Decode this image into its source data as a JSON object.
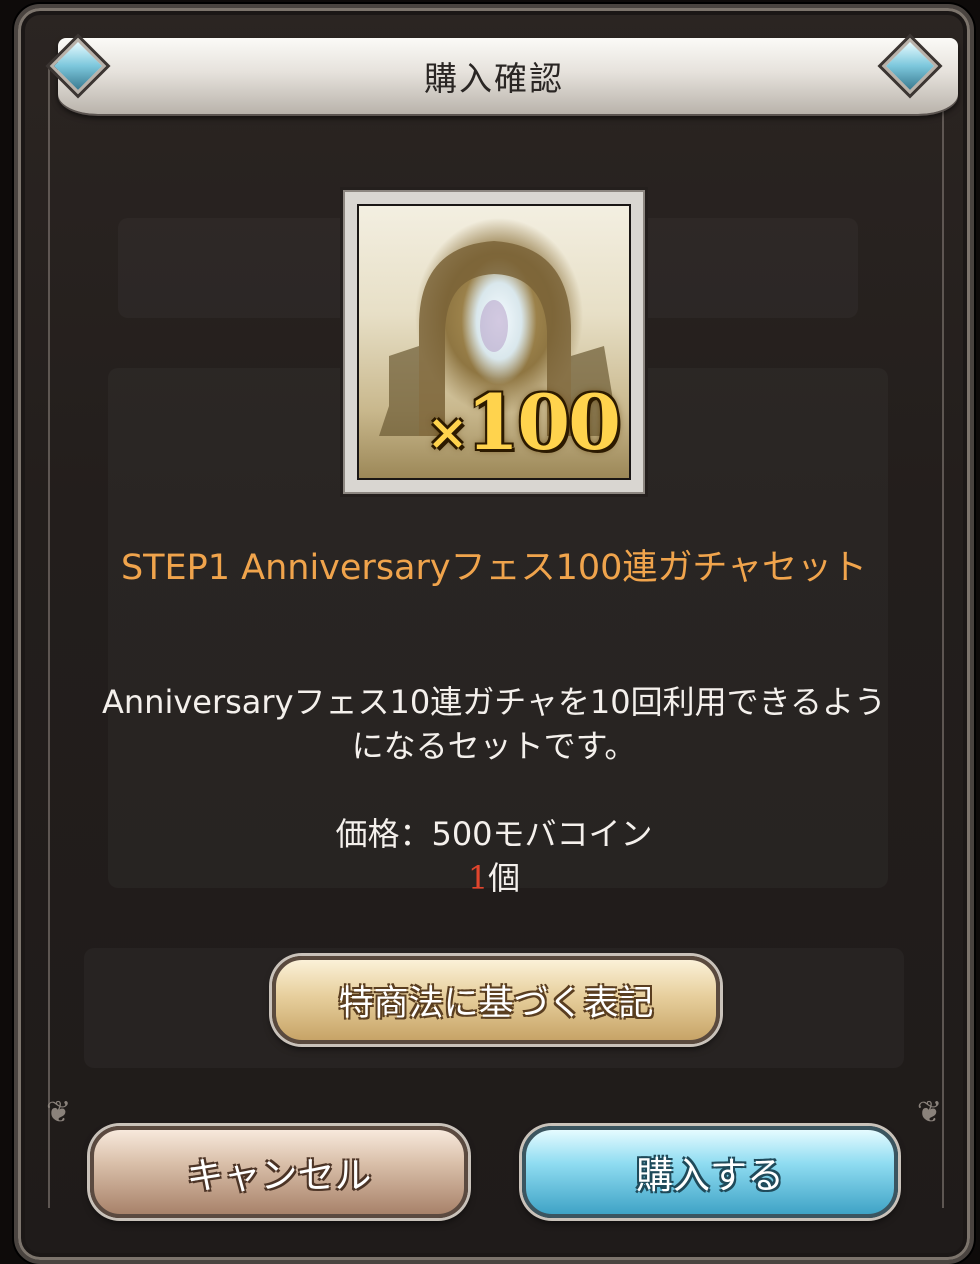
{
  "dialog": {
    "title": "購入確認",
    "item": {
      "quantity_prefix": "×",
      "quantity_value": "100",
      "icon": "gacha-ticket-icon"
    },
    "product_title": "STEP1 Anniversaryフェス100連ガチャセット",
    "description": "Anniversaryフェス10連ガチャを10回利用できるようになるセットです。",
    "price_text": "価格：500モバコイン",
    "quantity_number": "1",
    "quantity_unit": "個",
    "legal_button_label": "特商法に基づく表記",
    "cancel_button_label": "キャンセル",
    "buy_button_label": "購入する"
  },
  "colors": {
    "product_title": "#f0a44c",
    "quantity_number": "#e0452d",
    "buy_button": "#8fdcf1",
    "cancel_button": "#d9bfa9",
    "legal_button": "#e7cf9d"
  }
}
